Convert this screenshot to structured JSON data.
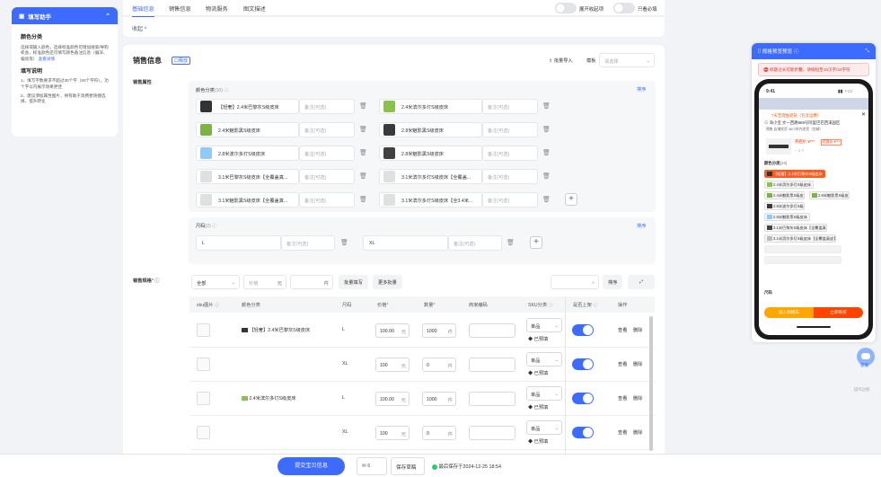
{
  "helper": {
    "title": "填写助手",
    "color_title": "颜色分类",
    "color_desc": "选择或输入颜色，选择标准颜色可增加搜索/导购机会，标准颜色还可填写颜色备注信息（偏深、偏亮等）",
    "color_link": "查看详情",
    "fill_title": "填写说明",
    "fill_1": "1、填写字数要求不超过30个字（60个字符），功个字以内展示效果更佳",
    "fill_2": "2、建议添加属性图片，将有助于消费者快捷选择，提升转化"
  },
  "tabs": [
    "基础信息",
    "销售信息",
    "物流服务",
    "图文描述"
  ],
  "toggles": {
    "expand_label": "展开收起项",
    "required_label": "只看必填"
  },
  "collapse_label": "收起 ^",
  "sales": {
    "title": "销售信息",
    "badge": "口释放",
    "batch_import": "批量导入",
    "template_label": "模板",
    "template_placeholder": "请选择",
    "attr_label": "销售属性",
    "color_label": "颜色分类",
    "color_count": "(10)",
    "sort": "排序",
    "remark_placeholder": "备注(可选)",
    "colors": [
      "【轻奢】2.4米巴黎灰S级皮床",
      "2.4米滨尔多灯S级皮床",
      "2.4米魅影黑S级皮床",
      "2.8米魅影黑S级皮床",
      "2.8米波尔多灯S级皮床",
      "2.8米魅影黑S级皮床",
      "3.1米巴黎灰S级皮床【全覆盖真...",
      "3.1米滨尔多灯S级皮床【全覆盖...",
      "3.1米魅影黑S级皮床【全覆盖真...",
      "3.1米滨尔多灯S级皮床【全3.4米..."
    ],
    "size_label": "尺码",
    "size_count": "(2)",
    "sizes": [
      "L",
      "XL"
    ],
    "spec_label": "销售规格",
    "filter_all": "全部",
    "filter_price": "价格",
    "price_unit": "元",
    "stock_unit": "件",
    "batch_fill": "批量填写",
    "more_batch": "更多批量",
    "table_headers": [
      "sku图片",
      "颜色分类",
      "尺码",
      "价格",
      "数量",
      "商家编码",
      "SKU分类",
      "是否上架",
      "操作"
    ],
    "rows": [
      {
        "color": "【轻奢】2.4米巴黎灰S级皮床",
        "size": "L",
        "price": "100.00",
        "qty": "1000",
        "sku_cat": "单品",
        "preset": "已预填",
        "view": "查看",
        "del": "删除"
      },
      {
        "color": "",
        "size": "XL",
        "price": "100",
        "qty": "0",
        "sku_cat": "单品",
        "preset": "已预填",
        "view": "查看",
        "del": "删除"
      },
      {
        "color": "2.4米滨尔多灯S级皮床",
        "size": "L",
        "price": "100.00",
        "qty": "1000",
        "sku_cat": "单品",
        "preset": "已预填",
        "view": "查看",
        "del": "删除"
      },
      {
        "color": "",
        "size": "XL",
        "price": "100",
        "qty": "0",
        "sku_cat": "单品",
        "preset": "已预填",
        "view": "查看",
        "del": "删除"
      }
    ]
  },
  "bottom": {
    "submit": "提交宝贝信息",
    "draft_count": "6",
    "save_draft": "保存草稿",
    "saved_at": "最后保存于2024-12-25 18:54"
  },
  "preview": {
    "title": "规格预览预览",
    "warning": "标题过长可能折叠，请缩短至16汉字/32字符",
    "time": "9:41",
    "promo": "7天无理由退货（包含运费）",
    "address": "海小宝 文一西路969号阿里巴巴西溪园区",
    "ship": "预售 店铺发货 48小时内发货（包邮）",
    "price_tag": "券后价 ¥***",
    "coupon": "优惠价 ¥***",
    "color_section": "颜色分类",
    "color_count": "(10)",
    "size_section": "尺码",
    "add_cart": "加入购物车",
    "buy_now": "立即购买",
    "chips": [
      "【轻奢】2.4米巴黎灰S级皮床",
      "2.4米滨尔多灯S级皮床",
      "2.4米魅影黑S级皮床",
      "2.8米魅影黑S级皮床",
      "2.8米波尔多灯S级皮床",
      "2.8米魅影黑S级皮床",
      "3.1米巴黎灰S级皮床【全覆盖真皮】",
      "3.1米滨尔多灯S级皮床【全覆盖真皮】"
    ]
  },
  "assistant": {
    "label": "客服",
    "action": "操作边框"
  }
}
